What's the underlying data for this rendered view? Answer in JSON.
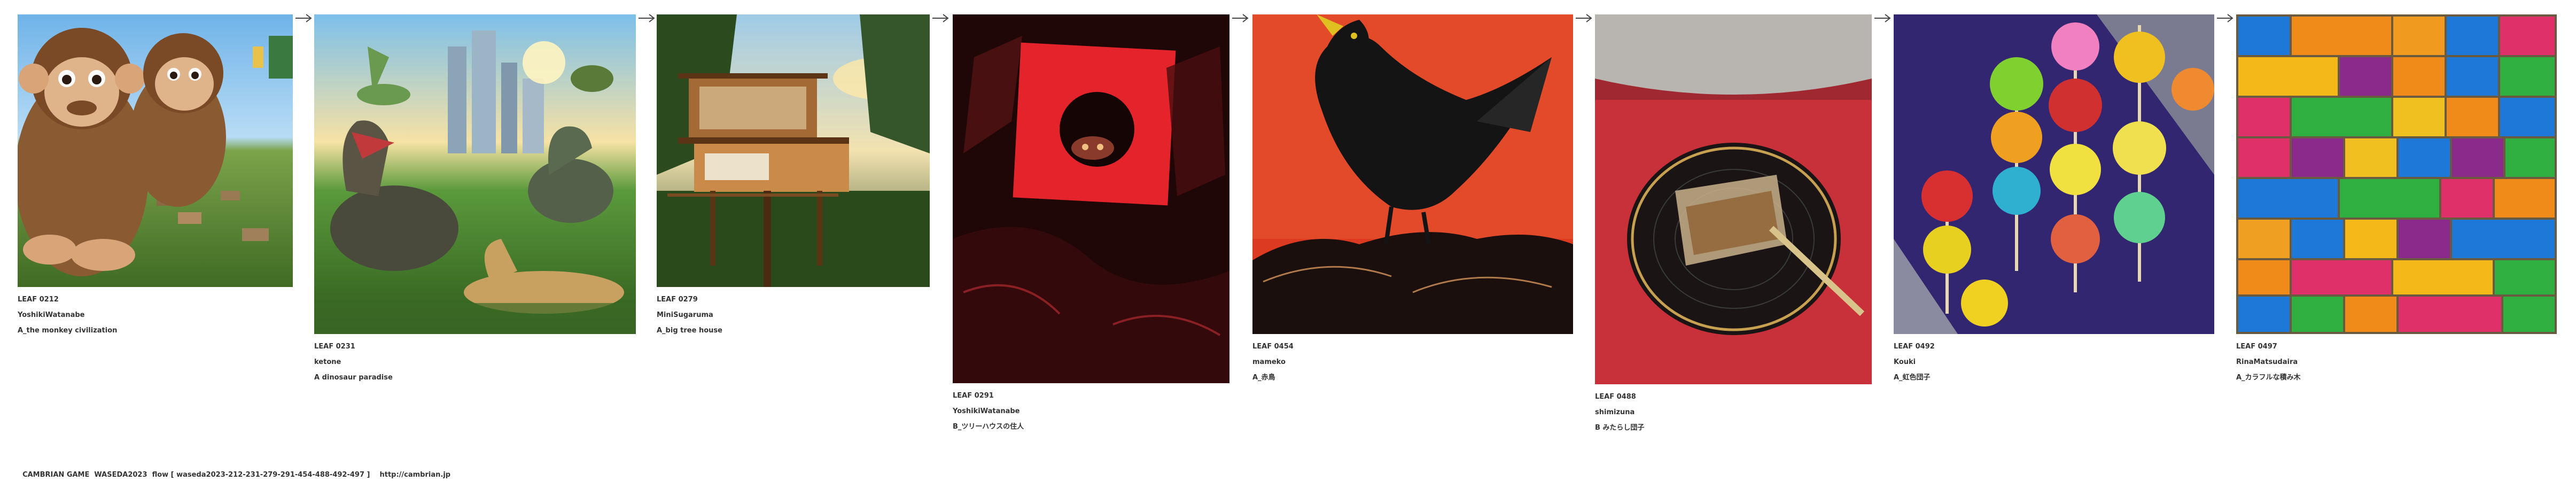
{
  "leaves": [
    {
      "id": "LEAF 0212",
      "author": "YoshikiWatanabe",
      "title": "A_the monkey civilization",
      "image": "monkeys-illustration"
    },
    {
      "id": "LEAF 0231",
      "author": "ketone",
      "title": "A dinosaur paradise",
      "image": "dinosaurs-city-illustration"
    },
    {
      "id": "LEAF 0279",
      "author": "MiniSugaruma",
      "title": "A_big tree house",
      "image": "treehouse-photo"
    },
    {
      "id": "LEAF 0291",
      "author": "YoshikiWatanabe",
      "title": "B_ツリーハウスの住人",
      "image": "red-window-creature"
    },
    {
      "id": "LEAF 0454",
      "author": "mameko",
      "title": "A_赤鳥",
      "image": "black-crow-red-background"
    },
    {
      "id": "LEAF 0488",
      "author": "shimizuna",
      "title": "B みたらし団子",
      "image": "dango-on-plate"
    },
    {
      "id": "LEAF 0492",
      "author": "Kouki",
      "title": "A_虹色団子",
      "image": "rainbow-dango-skewers"
    },
    {
      "id": "LEAF 0497",
      "author": "RinaMatsudaira",
      "title": "A_カラフルな積み木",
      "image": "colorful-blocks"
    }
  ],
  "footer": {
    "game": "CAMBRIAN GAME  WASEDA2023  flow [ waseda2023-212-231-279-291-454-488-492-497 ]",
    "url": "http://cambrian.jp"
  },
  "colors": {
    "accent": "#e8372b",
    "text": "#333333",
    "arrow": "#444444"
  }
}
